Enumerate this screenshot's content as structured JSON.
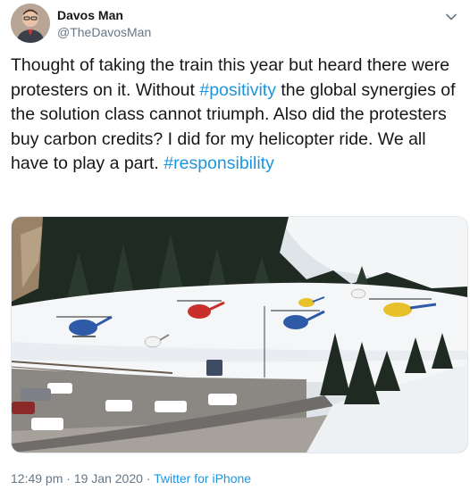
{
  "author": {
    "display_name": "Davos Man",
    "handle": "@TheDavosMan"
  },
  "tweet": {
    "text_1": "Thought of taking the train this year but heard there were protesters on it. Without ",
    "hashtag_1": "#positivity",
    "text_2": " the global synergies of the solution class cannot triumph. Also did the protesters buy carbon credits? I did for my helicopter ride. We all have to play a part. ",
    "hashtag_2": "#responsibility"
  },
  "media": {
    "helicopters": [
      "blue",
      "red",
      "white",
      "blue",
      "yellow",
      "white",
      "yellow"
    ]
  },
  "meta": {
    "time": "12:49 pm",
    "separator_1": " · ",
    "date": "19 Jan 2020",
    "separator_2": " · ",
    "source": "Twitter for iPhone"
  },
  "icons": {
    "menu": "chevron-down-icon"
  },
  "colors": {
    "link": "#1b95e0",
    "secondary_text": "#657786"
  }
}
